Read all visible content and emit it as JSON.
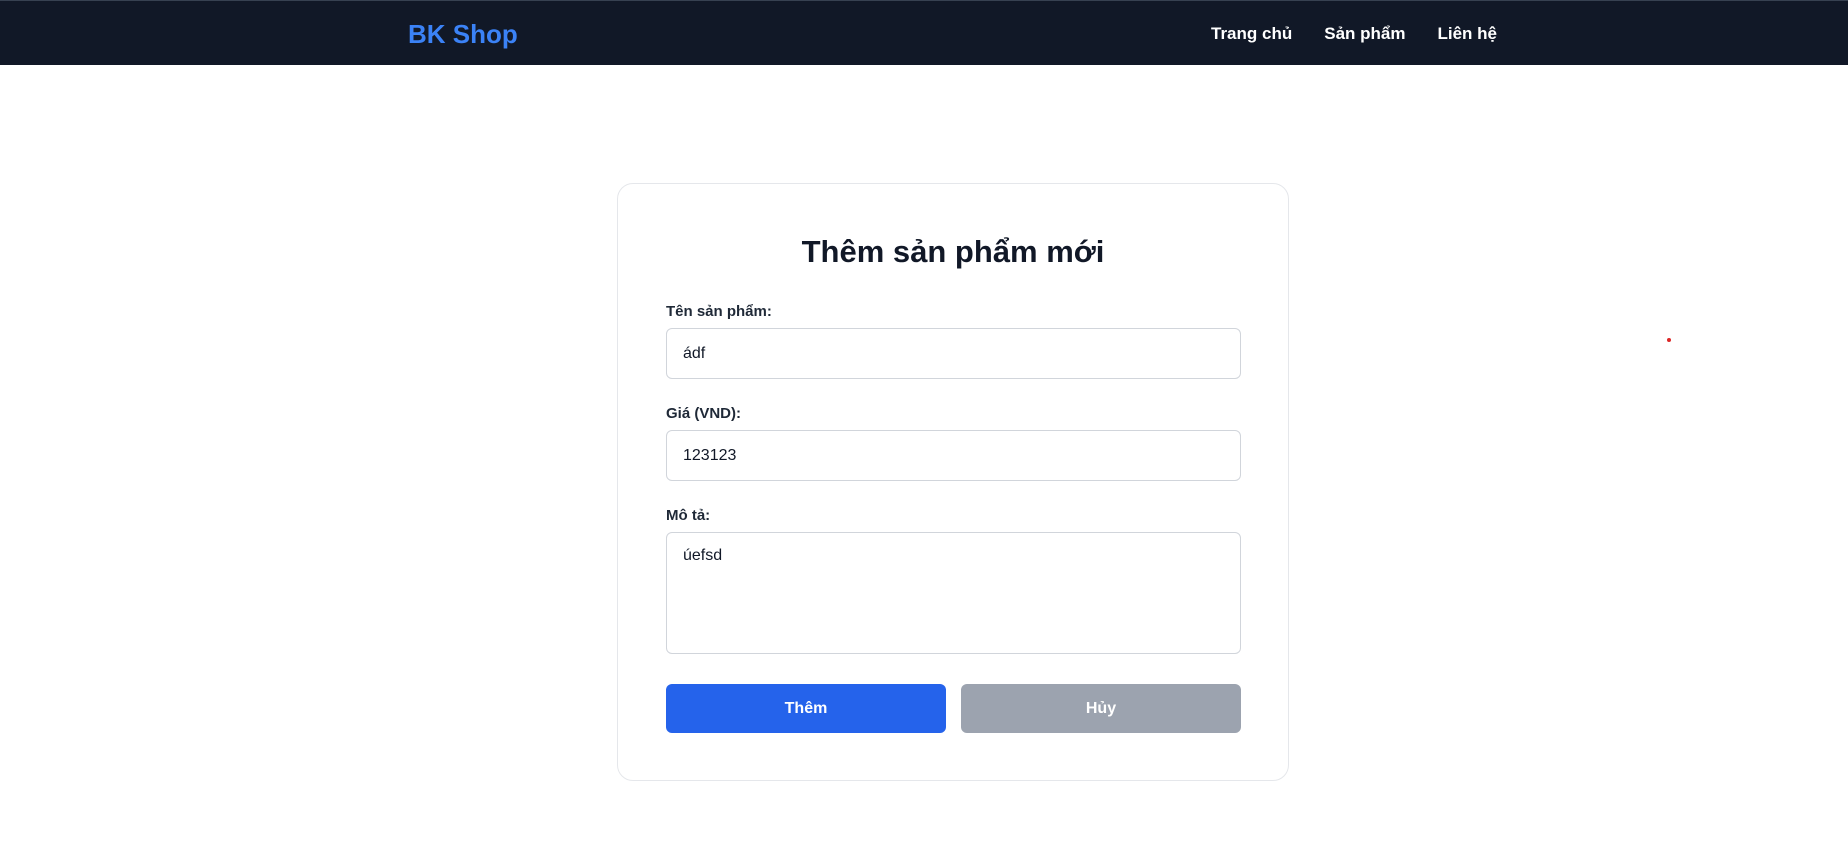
{
  "navbar": {
    "brand": "BK Shop",
    "links": [
      {
        "label": "Trang chủ"
      },
      {
        "label": "Sản phẩm"
      },
      {
        "label": "Liên hệ"
      }
    ]
  },
  "form": {
    "title": "Thêm sản phẩm mới",
    "name_field": {
      "label": "Tên sản phẩm:",
      "value": "ádf"
    },
    "price_field": {
      "label": "Giá (VND):",
      "value": "123123"
    },
    "description_field": {
      "label": "Mô tả:",
      "value": "úefsd"
    },
    "submit_label": "Thêm",
    "cancel_label": "Hủy"
  },
  "colors": {
    "navbar_bg": "#111827",
    "brand": "#3b82f6",
    "submit_bg": "#2563eb",
    "cancel_bg": "#9ca3af"
  }
}
